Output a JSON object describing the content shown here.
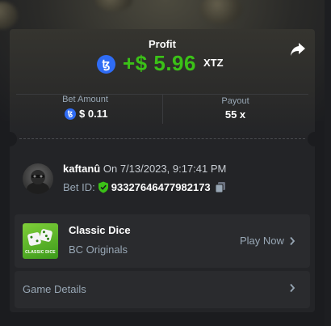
{
  "header": {
    "profit_label": "Profit",
    "profit_amount": "+$ 5.96",
    "profit_currency": "XTZ"
  },
  "stats": {
    "bet_amount_label": "Bet Amount",
    "bet_amount_value": "$ 0.11",
    "payout_label": "Payout",
    "payout_value": "55 x"
  },
  "bet_info": {
    "username": "kaftanû",
    "date_text": "On 7/13/2023, 9:17:41 PM",
    "bet_id_label": "Bet ID:",
    "bet_id_value": "93327646477982173"
  },
  "game": {
    "title": "Classic Dice",
    "provider": "BC Originals",
    "thumb_label": "CLASSIC DICE",
    "play_label": "Play Now"
  },
  "details": {
    "label": "Game Details"
  },
  "colors": {
    "profit_green": "#3bc117",
    "tezos_blue": "#2f6cf5",
    "verified_green": "#3bc117",
    "muted_text": "#98a7b5"
  }
}
